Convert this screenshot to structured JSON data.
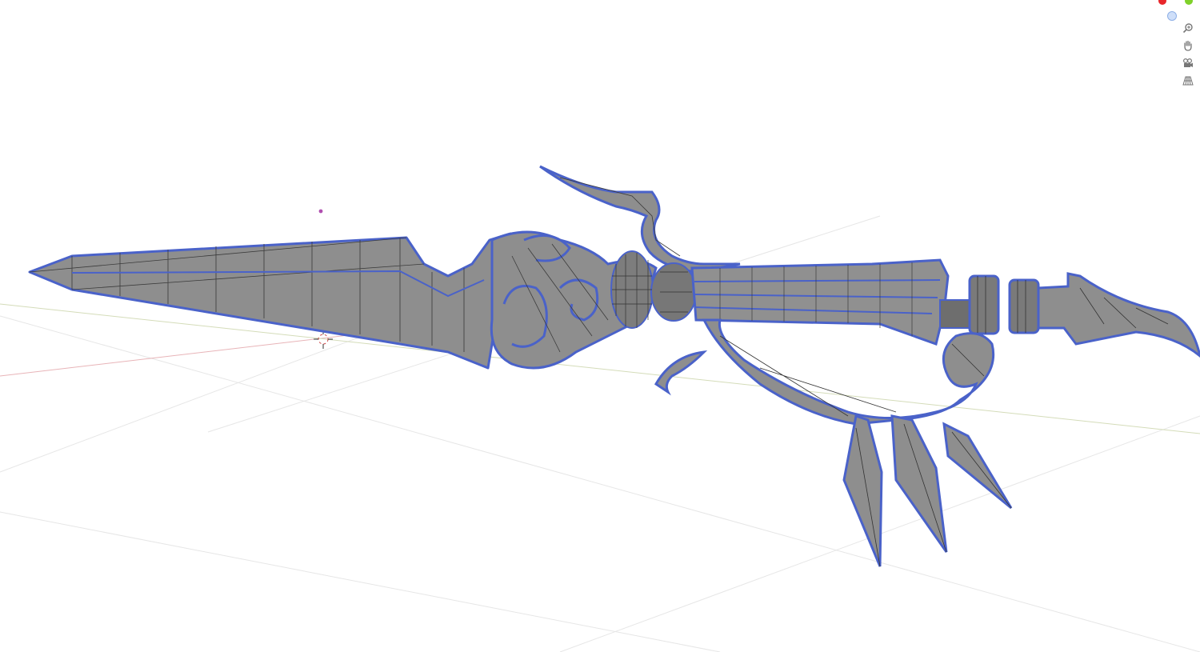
{
  "app": {
    "kind": "3d-viewport"
  },
  "colors": {
    "background": "#ffffff",
    "mesh_fill": "#8e8e8e",
    "mesh_fill_dark": "#6c6c6c",
    "edge_wire": "#2b2b2b",
    "selection_outline": "#4a62c9",
    "x_axis": "#e8b4b8",
    "y_axis": "#cfd8b0",
    "grid": "#e4e4e4",
    "axis_x_dot": "#e8262b",
    "axis_y_dot": "#7fd12a",
    "axis_z_dot": "#a9c7f3",
    "light_dot": "#b04fb0"
  },
  "gizmo": {
    "axes": [
      {
        "name": "x-axis",
        "color": "#e8262b"
      },
      {
        "name": "y-axis",
        "color": "#7fd12a"
      },
      {
        "name": "z-axis",
        "color": "#a9c7f3"
      }
    ],
    "buttons": [
      {
        "name": "zoom-icon"
      },
      {
        "name": "hand-pan-icon"
      },
      {
        "name": "camera-view-icon"
      },
      {
        "name": "perspective-grid-icon"
      }
    ]
  },
  "scene": {
    "object": "dagger-mesh",
    "cursor": "3d-cursor",
    "light": "light-object"
  }
}
